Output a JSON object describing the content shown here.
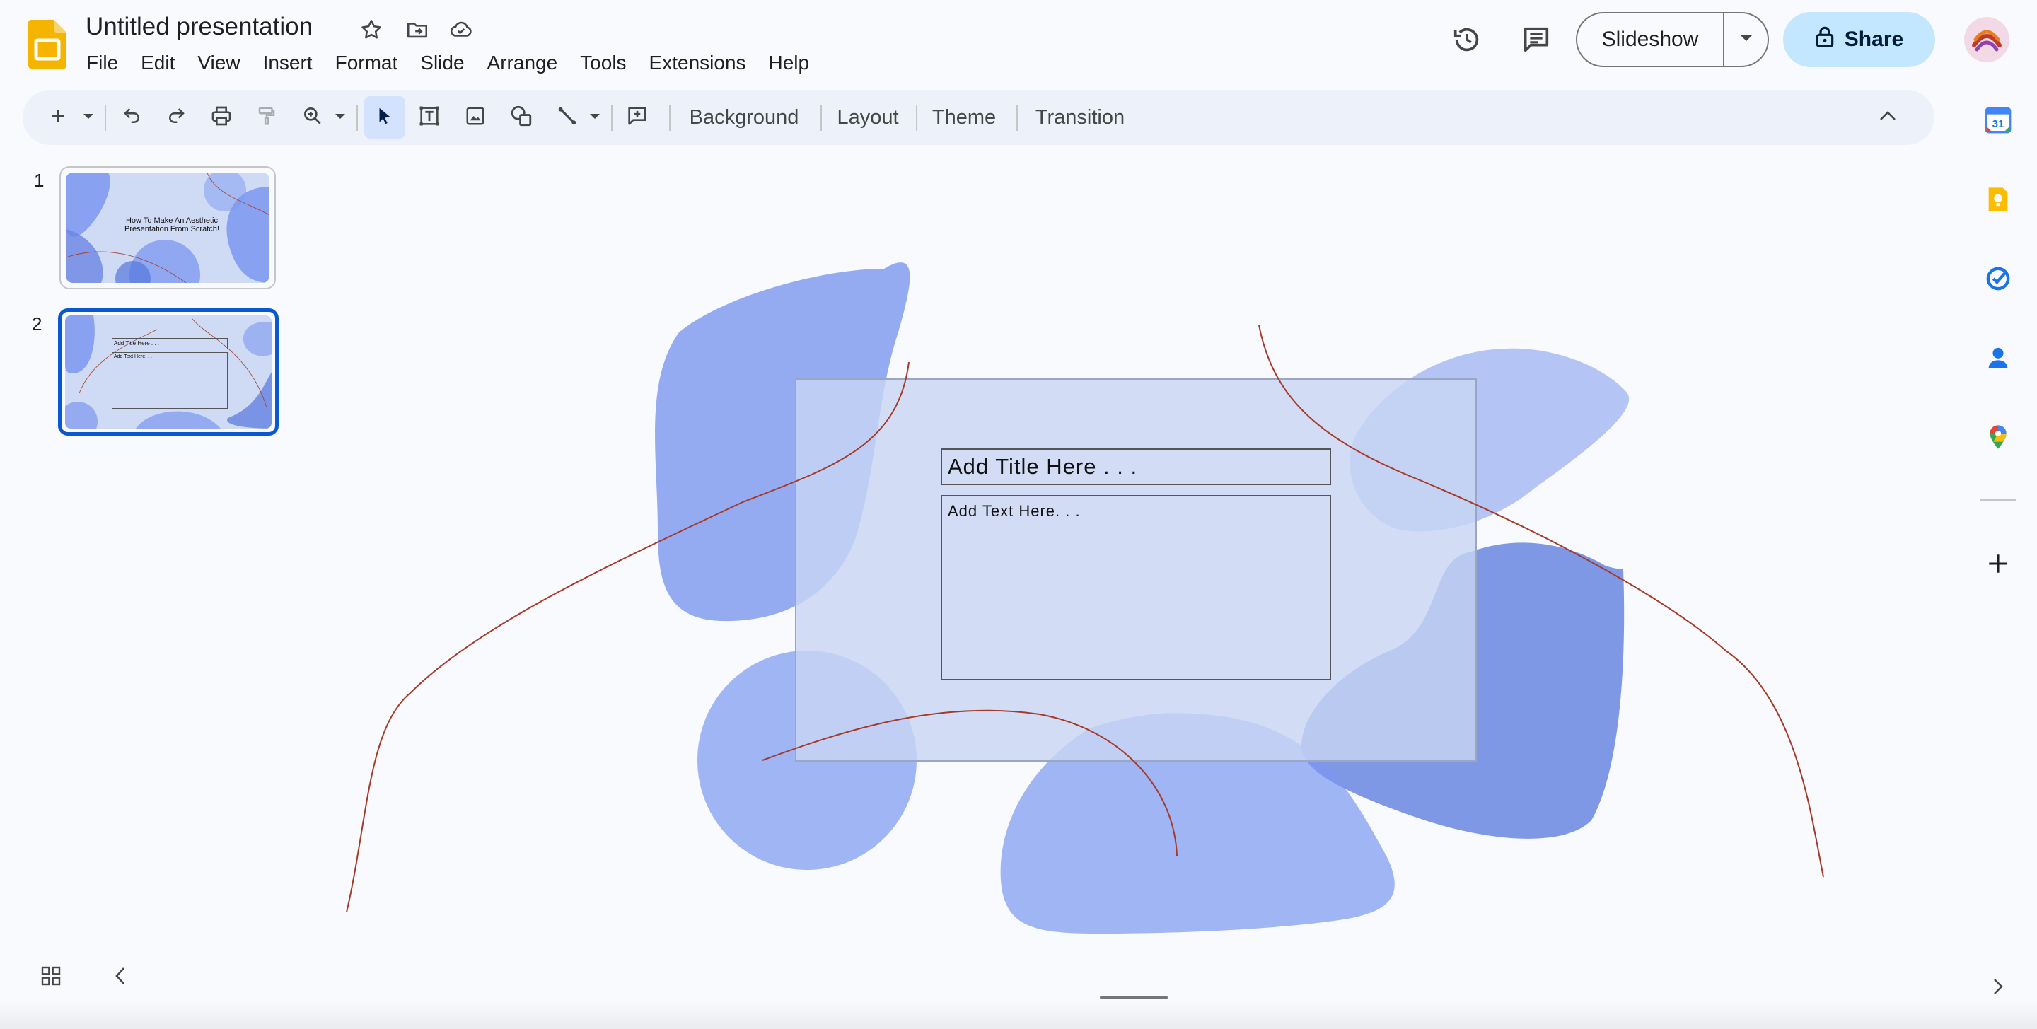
{
  "header": {
    "title": "Untitled presentation",
    "menu": [
      "File",
      "Edit",
      "View",
      "Insert",
      "Format",
      "Slide",
      "Arrange",
      "Tools",
      "Extensions",
      "Help"
    ],
    "slideshow_label": "Slideshow",
    "share_label": "Share"
  },
  "toolbar": {
    "background_label": "Background",
    "layout_label": "Layout",
    "theme_label": "Theme",
    "transition_label": "Transition"
  },
  "slides_panel": {
    "slides": [
      {
        "number": "1",
        "title": "How To Make An Aesthetic",
        "title2": "Presentation From Scratch!"
      },
      {
        "number": "2",
        "title": "Add Title Here . . .",
        "text": "Add Text Here. . ."
      }
    ]
  },
  "slide": {
    "title_placeholder": "Add Title Here . . .",
    "text_placeholder": "Add Text Here. . ."
  },
  "colors": {
    "accent": "#0b57d0",
    "share_bg": "#c2e7ff",
    "blob": "#7b97ef",
    "slide_rect": "#c8d6f3",
    "curve": "#a63a2a"
  },
  "icons": {
    "right_panel": [
      "calendar-icon",
      "keep-icon",
      "tasks-icon",
      "contacts-icon",
      "maps-icon",
      "plus-icon"
    ]
  }
}
